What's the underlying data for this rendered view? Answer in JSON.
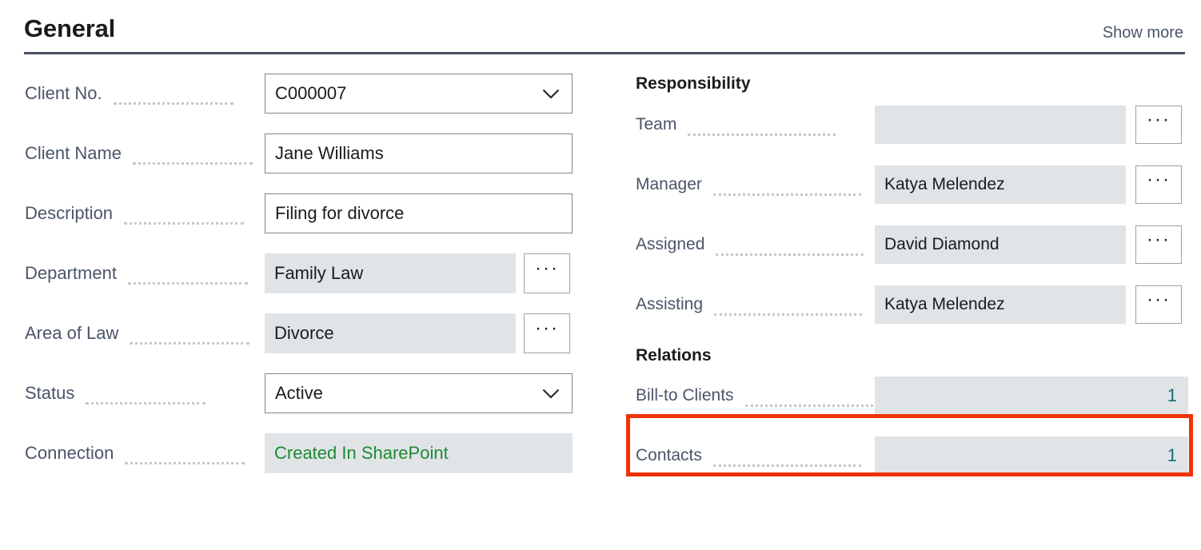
{
  "header": {
    "title": "General",
    "show_more_label": "Show more"
  },
  "left_column": {
    "fields": [
      {
        "label": "Client No.",
        "value": "C000007",
        "control": "dropdown"
      },
      {
        "label": "Client Name",
        "value": "Jane Williams",
        "control": "text"
      },
      {
        "label": "Description",
        "value": "Filing for divorce",
        "control": "text"
      },
      {
        "label": "Department",
        "value": "Family Law",
        "control": "lookup"
      },
      {
        "label": "Area of Law",
        "value": "Divorce",
        "control": "lookup"
      },
      {
        "label": "Status",
        "value": "Active",
        "control": "dropdown"
      },
      {
        "label": "Connection",
        "value": "Created In SharePoint",
        "control": "readonly-green"
      }
    ]
  },
  "right_column": {
    "responsibility": {
      "heading": "Responsibility",
      "fields": [
        {
          "label": "Team",
          "value": "",
          "control": "lookup"
        },
        {
          "label": "Manager",
          "value": "Katya Melendez",
          "control": "lookup"
        },
        {
          "label": "Assigned",
          "value": "David Diamond",
          "control": "lookup"
        },
        {
          "label": "Assisting",
          "value": "Katya Melendez",
          "control": "lookup"
        }
      ]
    },
    "relations": {
      "heading": "Relations",
      "fields": [
        {
          "label": "Bill-to Clients",
          "value": "1",
          "control": "count",
          "highlighted": true
        },
        {
          "label": "Contacts",
          "value": "1",
          "control": "count",
          "highlighted": false
        }
      ]
    }
  },
  "icons": {
    "chevron_down": "chevron-down-icon",
    "ellipsis": "···"
  },
  "colors": {
    "accent_rule": "#4a5163",
    "label_text": "#4a5568",
    "field_fill": "#e0e4e7",
    "field_border": "#7b8794",
    "green_value": "#1f8a33",
    "teal_count": "#136c75",
    "annotation_red": "#f03205"
  }
}
